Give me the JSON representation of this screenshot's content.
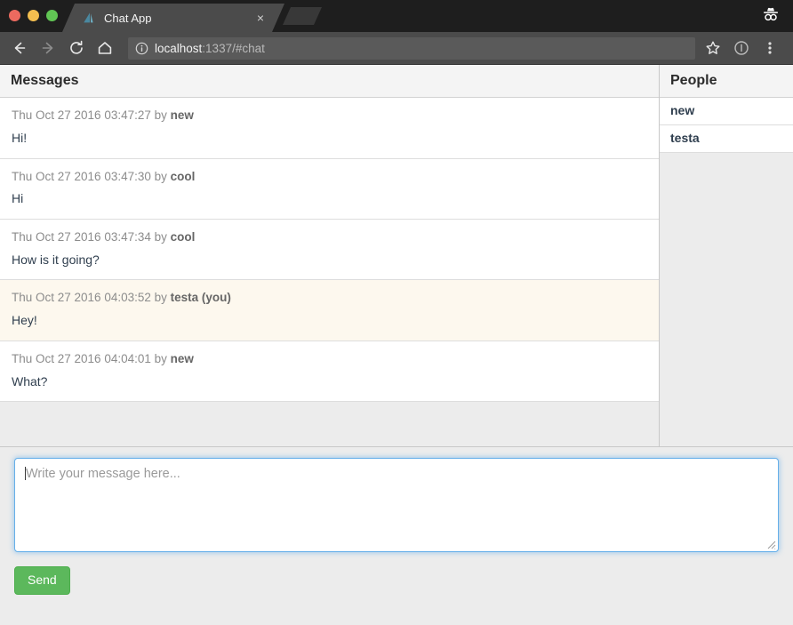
{
  "browser": {
    "tab": {
      "title": "Chat App",
      "favicon_name": "sail-icon",
      "close_label": "×"
    },
    "new_tab_label": "",
    "incognito_icon": "incognito-icon",
    "nav": {
      "back_label": "Back",
      "forward_label": "Forward",
      "reload_label": "Reload",
      "home_label": "Home"
    },
    "omnibox": {
      "info_icon": "site-info-icon",
      "host": "localhost",
      "rest": ":1337/#chat",
      "full_url": "localhost:1337/#chat"
    },
    "actions": {
      "bookmark_icon": "star-icon",
      "profile_icon": "account-circle-icon",
      "menu_icon": "three-dot-menu-icon"
    },
    "colors": {
      "chrome_bg": "#1e1e1e",
      "toolbar_bg": "#4b4b4b",
      "tab_active_bg": "#4b4b4b",
      "omnibox_bg": "#5a5a5a"
    }
  },
  "app": {
    "messages_panel": {
      "title": "Messages",
      "messages": [
        {
          "timestamp": "Thu Oct 27 2016 03:47:27",
          "by_label": "by",
          "author": "new",
          "text": "Hi!",
          "mine": false
        },
        {
          "timestamp": "Thu Oct 27 2016 03:47:30",
          "by_label": "by",
          "author": "cool",
          "text": "Hi",
          "mine": false
        },
        {
          "timestamp": "Thu Oct 27 2016 03:47:34",
          "by_label": "by",
          "author": "cool",
          "text": "How is it going?",
          "mine": false
        },
        {
          "timestamp": "Thu Oct 27 2016 04:03:52",
          "by_label": "by",
          "author": "testa (you)",
          "text": "Hey!",
          "mine": true
        },
        {
          "timestamp": "Thu Oct 27 2016 04:04:01",
          "by_label": "by",
          "author": "new",
          "text": "What?",
          "mine": false
        }
      ]
    },
    "people_panel": {
      "title": "People",
      "people": [
        {
          "name": "new"
        },
        {
          "name": "testa"
        }
      ]
    },
    "composer": {
      "placeholder": "Write your message here...",
      "value": "",
      "focused": true,
      "send_label": "Send"
    },
    "colors": {
      "page_bg": "#ececec",
      "panel_head_bg": "#f4f4f4",
      "row_bg": "#ffffff",
      "own_message_bg": "#fdf8ee",
      "send_green": "#5cb85c",
      "focus_blue": "#66afe9",
      "text_body": "#2f3e4e",
      "text_muted": "#8c8c8c"
    }
  }
}
